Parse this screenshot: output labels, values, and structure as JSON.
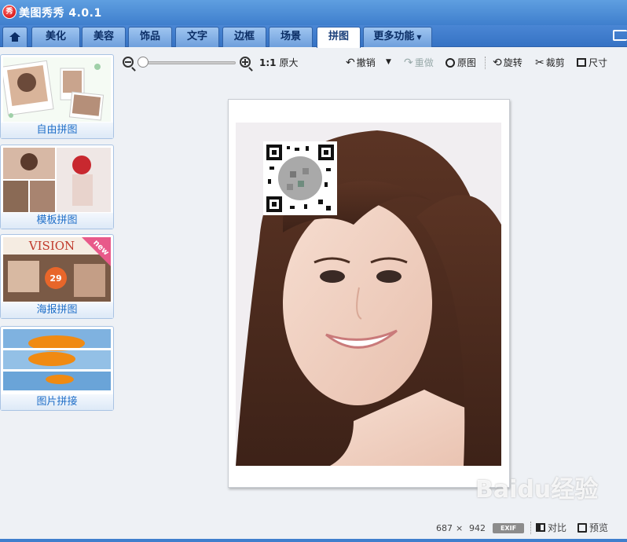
{
  "app": {
    "logo_char": "秀",
    "title": "美图秀秀 4.0.1"
  },
  "tabs": [
    {
      "label": "",
      "icon": "home-icon"
    },
    {
      "label": "美化"
    },
    {
      "label": "美容"
    },
    {
      "label": "饰品"
    },
    {
      "label": "文字"
    },
    {
      "label": "边框"
    },
    {
      "label": "场景"
    },
    {
      "label": "拼图",
      "active": true
    },
    {
      "label": "更多功能"
    }
  ],
  "sidebar": {
    "items": [
      {
        "label": "自由拼图"
      },
      {
        "label": "模板拼图"
      },
      {
        "label": "海报拼图",
        "badge": "new",
        "poster_text": "VISION",
        "poster_number": "29"
      },
      {
        "label": "图片拼接"
      }
    ]
  },
  "toolbar": {
    "zoom_ratio": "1:1",
    "original_size": "原大",
    "undo": "撤销",
    "redo": "重做",
    "original": "原图",
    "rotate": "旋转",
    "crop": "裁剪",
    "size": "尺寸"
  },
  "status": {
    "width": "687",
    "times": "×",
    "height": "942",
    "exif": "EXIF",
    "compare": "对比",
    "preview": "预览"
  },
  "watermark": "Baidu经验",
  "colors": {
    "accent": "#3f7fcd",
    "link": "#1e6ec8",
    "new_badge": "#e85a8a"
  }
}
